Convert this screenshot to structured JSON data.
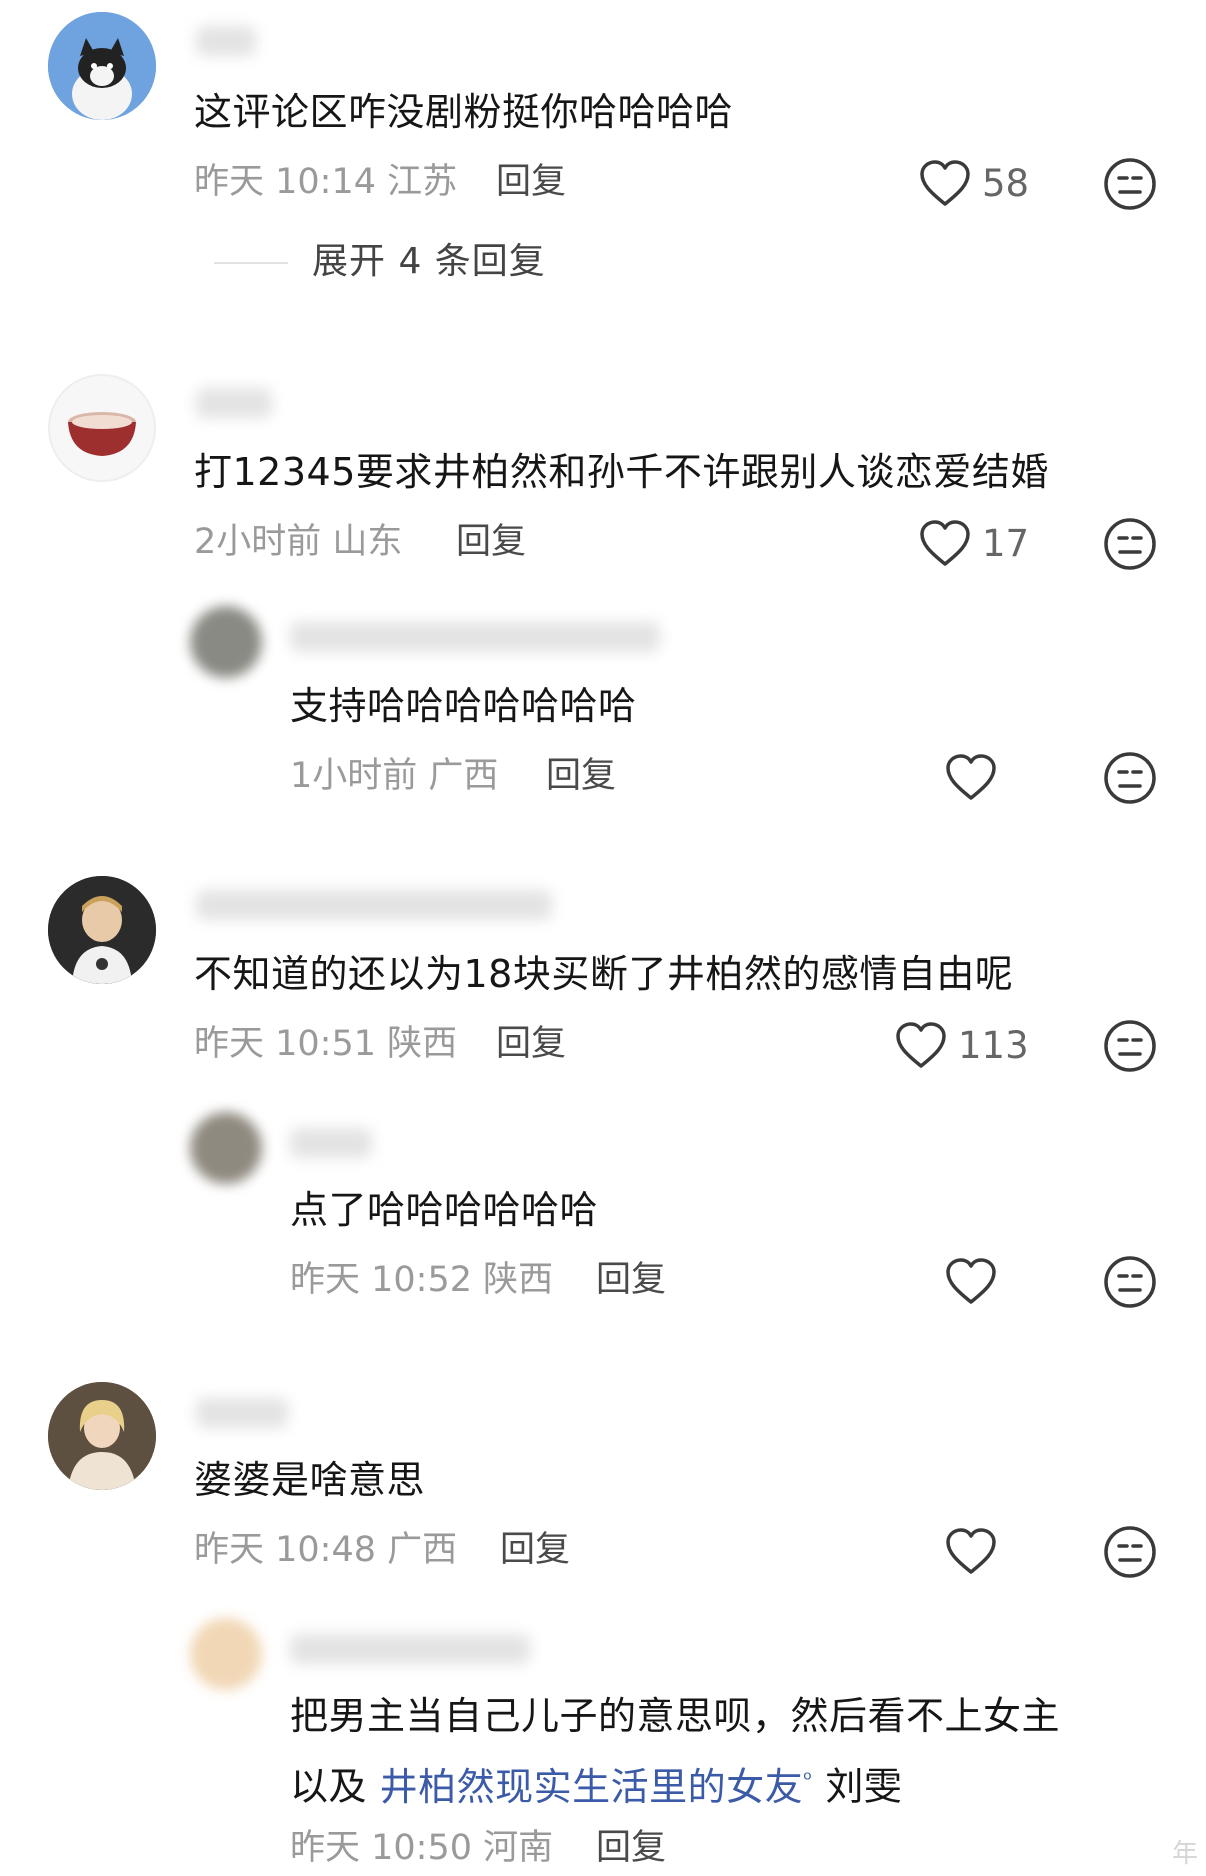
{
  "comments": [
    {
      "text": "这评论区咋没剧粉挺你哈哈哈哈",
      "time": "昨天 10:14",
      "location": "江苏",
      "reply_label": "回复",
      "likes": "58",
      "expand_label": "展开 4 条回复"
    },
    {
      "text": "打12345要求井柏然和孙千不许跟别人谈恋爱结婚",
      "time": "2小时前",
      "location": "山东",
      "reply_label": "回复",
      "likes": "17"
    },
    {
      "text": "支持哈哈哈哈哈哈哈",
      "time": "1小时前",
      "location": "广西",
      "reply_label": "回复"
    },
    {
      "text": "不知道的还以为18块买断了井柏然的感情自由呢",
      "time": "昨天 10:51",
      "location": "陕西",
      "reply_label": "回复",
      "likes": "113"
    },
    {
      "text": "点了哈哈哈哈哈哈",
      "time": "昨天 10:52",
      "location": "陕西",
      "reply_label": "回复"
    },
    {
      "text": "婆婆是啥意思",
      "time": "昨天 10:48",
      "location": "广西",
      "reply_label": "回复"
    },
    {
      "text_line1": "把男主当自己儿子的意思呗，然后看不上女主",
      "text_line2_prefix": "以及",
      "text_line2_link": "井柏然现实生活里的女友",
      "text_line2_suffix": "刘雯",
      "time": "昨天 10:50",
      "location": "河南",
      "reply_label": "回复"
    }
  ],
  "watermark": "年",
  "colors": {
    "text": "#161616",
    "meta": "#9a9a9a",
    "link": "#3b5aa8",
    "icon": "#3a3a3a"
  },
  "icons": [
    "heart-outline-icon",
    "meh-face-icon"
  ]
}
